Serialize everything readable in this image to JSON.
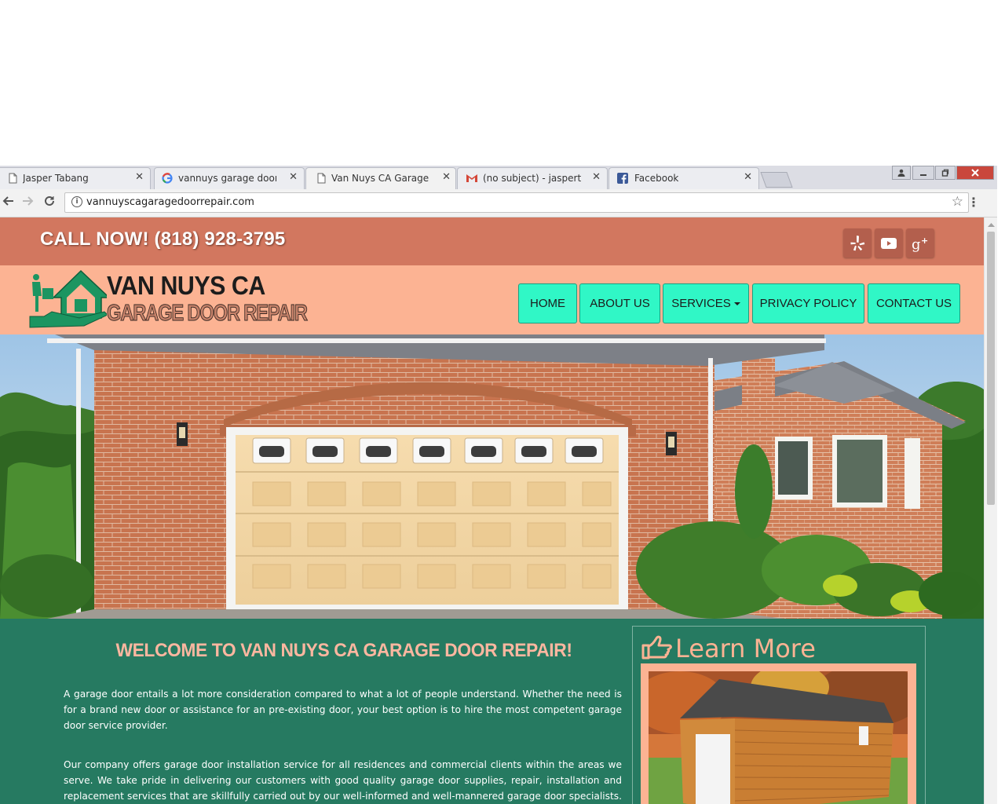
{
  "browser": {
    "tabs": [
      {
        "label": "Jasper Tabang",
        "icon": "page-icon",
        "active": false
      },
      {
        "label": "vannuys garage door pa",
        "icon": "google-icon",
        "active": false
      },
      {
        "label": "Van Nuys CA Garage Doo",
        "icon": "page-icon",
        "active": true
      },
      {
        "label": "(no subject) - jaspertabai",
        "icon": "gmail-icon",
        "active": false
      },
      {
        "label": "Facebook",
        "icon": "facebook-icon",
        "active": false
      }
    ],
    "close_glyph": "✕",
    "url": "vannuyscagaragedoorrepair.com"
  },
  "site": {
    "call_now": "CALL NOW! (818) 928-3795",
    "social": [
      "yelp-icon",
      "youtube-icon",
      "google-plus-icon"
    ],
    "logo": {
      "line1": "VAN NUYS CA",
      "line2": "GARAGE DOOR REPAIR"
    },
    "nav": [
      {
        "label": "HOME"
      },
      {
        "label": "ABOUT US"
      },
      {
        "label": "SERVICES",
        "dropdown": true
      },
      {
        "label": "PRIVACY POLICY"
      },
      {
        "label": "CONTACT US"
      }
    ],
    "welcome_title": "WELCOME TO VAN NUYS CA GARAGE DOOR REPAIR!",
    "paragraphs": [
      "A garage door entails a lot more consideration compared to what a lot of people understand. Whether the need is for a brand new door or assistance for an pre-existing door, your best option is to hire the most competent garage door service provider.",
      "Our company offers garage door installation service for all residences and commercial clients within the areas we serve. We take pride in delivering our customers with good quality garage door supplies, repair, installation and replacement services that are skillfully carried out by our well-informed and well-mannered garage door specialists. Parts department"
    ],
    "sidebar_title": "Learn More"
  },
  "colors": {
    "topbar": "#d2775f",
    "header": "#fcb393",
    "nav_button": "#30f7c6",
    "content_bg": "#267a61",
    "title_pink": "#fcb7a0"
  }
}
